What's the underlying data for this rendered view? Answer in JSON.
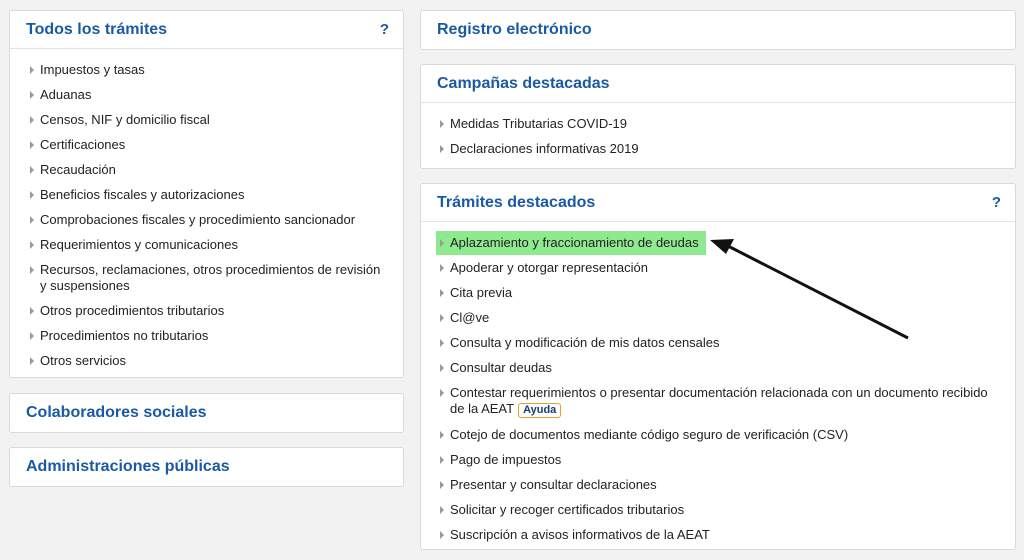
{
  "left_panel": {
    "title": "Todos los trámites",
    "help": "?",
    "items": [
      "Impuestos y tasas",
      "Aduanas",
      "Censos, NIF y domicilio fiscal",
      "Certificaciones",
      "Recaudación",
      "Beneficios fiscales y autorizaciones",
      "Comprobaciones fiscales y procedimiento sancionador",
      "Requerimientos y comunicaciones",
      "Recursos, reclamaciones, otros procedimientos de revisión",
      "y suspensiones",
      "Otros procedimientos tributarios",
      "Procedimientos no tributarios",
      "Otros servicios"
    ]
  },
  "colaboradores": {
    "title": "Colaboradores sociales"
  },
  "administraciones": {
    "title": "Administraciones públicas"
  },
  "registro": {
    "title": "Registro electrónico"
  },
  "campanas": {
    "title": "Campañas destacadas",
    "items": [
      "Medidas Tributarias COVID-19",
      "Declaraciones informativas 2019"
    ]
  },
  "tramites": {
    "title": "Trámites destacados",
    "help": "?",
    "items": [
      "Aplazamiento y fraccionamiento de deudas",
      "Apoderar y otorgar representación",
      "Cita previa",
      "Cl@ve",
      "Consulta y modificación de mis datos censales",
      "Consultar deudas",
      "Contestar requerimientos o presentar documentación relacionada con un documento recibido",
      "de la AEAT",
      "Cotejo de documentos mediante código seguro de verificación (CSV)",
      "Pago de impuestos",
      "Presentar y consultar declaraciones",
      "Solicitar y recoger certificados tributarios",
      "Suscripción a avisos informativos de la AEAT"
    ],
    "help_badge": "Ayuda"
  },
  "colors": {
    "accent": "#1a5aa5",
    "highlight": "#8fea8f",
    "badge_border": "#e0a22a"
  }
}
